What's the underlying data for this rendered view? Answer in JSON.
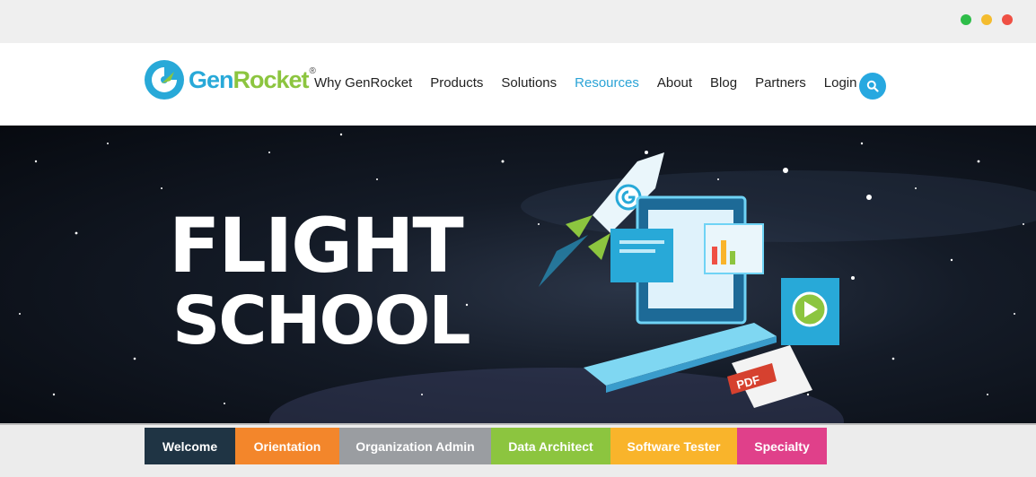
{
  "window": {
    "controls": [
      {
        "name": "maximize",
        "color": "#2ebd49"
      },
      {
        "name": "minimize",
        "color": "#f4bc2e"
      },
      {
        "name": "close",
        "color": "#ef5044"
      }
    ]
  },
  "brand": {
    "gen": "Gen",
    "rocket": "Rocket",
    "reg": "®",
    "blue": "#28a9d8",
    "green": "#8cc53f"
  },
  "nav": {
    "items": [
      "Why GenRocket",
      "Products",
      "Solutions",
      "Resources",
      "About",
      "Blog",
      "Partners",
      "Login"
    ],
    "active": "Resources",
    "search_icon": "search-icon"
  },
  "hero": {
    "line1": "FLIGHT",
    "line2": "SCHOOL",
    "pdf_label": "PDF"
  },
  "tabs": [
    {
      "label": "Welcome",
      "color": "#1f3444"
    },
    {
      "label": "Orientation",
      "color": "#f3862b"
    },
    {
      "label": "Organization Admin",
      "color": "#9a9da1"
    },
    {
      "label": "Data Architect",
      "color": "#8cc53f"
    },
    {
      "label": "Software Tester",
      "color": "#f9b42b"
    },
    {
      "label": "Specialty",
      "color": "#e0408a"
    }
  ]
}
